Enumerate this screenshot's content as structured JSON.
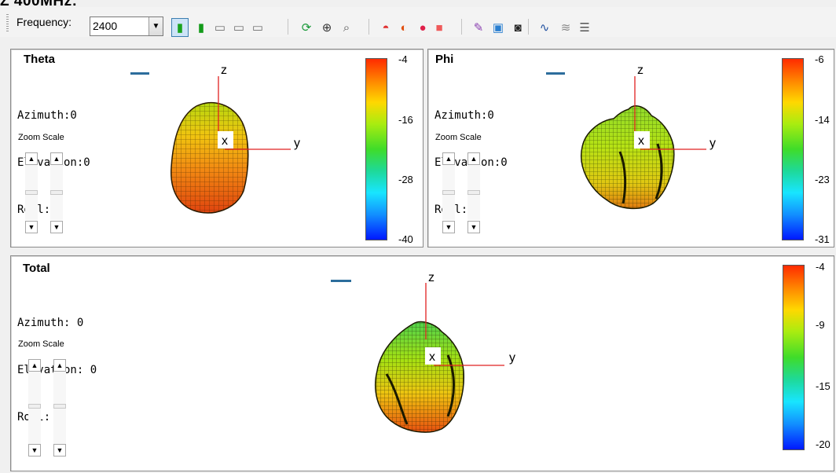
{
  "window": {
    "clipped_title": "Z 400MHz:"
  },
  "toolbar": {
    "frequency_label": "Frequency:",
    "frequency_value": "2400",
    "buttons": [
      {
        "name": "phone-view-icon",
        "glyph": "▮",
        "color": "#19a31c",
        "active": true
      },
      {
        "name": "phone-front-icon",
        "glyph": "▮",
        "color": "#139b1a",
        "active": false
      },
      {
        "name": "device-left-icon",
        "glyph": "▭",
        "color": "#707070",
        "active": false
      },
      {
        "name": "device-right-icon",
        "glyph": "▭",
        "color": "#707070",
        "active": false
      },
      {
        "name": "device-edit-icon",
        "glyph": "▭",
        "color": "#707070",
        "active": false
      },
      {
        "name": "rotate-icon",
        "glyph": "⟳",
        "color": "#1a9a3a",
        "active": false
      },
      {
        "name": "zoom-in-icon",
        "glyph": "⊕",
        "color": "#333333",
        "active": false
      },
      {
        "name": "zoom-out-icon",
        "glyph": "⌕",
        "color": "#555555",
        "active": false
      },
      {
        "name": "sphere-half-icon",
        "glyph": "◓",
        "color": "#e03030",
        "active": false
      },
      {
        "name": "sphere-split-icon",
        "glyph": "◐",
        "color": "#e05010",
        "active": false
      },
      {
        "name": "sphere-icon",
        "glyph": "●",
        "color": "#e0204a",
        "active": false
      },
      {
        "name": "cube-icon",
        "glyph": "■",
        "color": "#ef5a5a",
        "active": false
      },
      {
        "name": "pen-draw-icon",
        "glyph": "✎",
        "color": "#8a3fb0",
        "active": false
      },
      {
        "name": "export-image-icon",
        "glyph": "▣",
        "color": "#2a7fd0",
        "active": false
      },
      {
        "name": "camera-icon",
        "glyph": "◙",
        "color": "#222222",
        "active": false
      },
      {
        "name": "wave-icon",
        "glyph": "∿",
        "color": "#2050a0",
        "active": false
      },
      {
        "name": "multi-wave-icon",
        "glyph": "≋",
        "color": "#8a8a8a",
        "active": false
      },
      {
        "name": "notes-icon",
        "glyph": "☰",
        "color": "#555555",
        "active": false
      }
    ]
  },
  "panels": {
    "theta": {
      "title": "Theta",
      "azimuth": "Azimuth:0",
      "elevation": "Elevation:0",
      "roll": "Roll:0",
      "zoom_label": "Zoom Scale",
      "scale": [
        "-4",
        "-16",
        "-28",
        "-40"
      ]
    },
    "phi": {
      "title": "Phi",
      "azimuth": "Azimuth:0",
      "elevation": "Elevation:0",
      "roll": "Roll:0",
      "zoom_label": "Zoom Scale",
      "scale": [
        "-6",
        "-14",
        "-23",
        "-31"
      ]
    },
    "total": {
      "title": "Total",
      "azimuth": "Azimuth: 0",
      "elevation": "Elevation: 0",
      "roll": "Roll: 0",
      "zoom_label": "Zoom Scale",
      "scale": [
        "-4",
        "-9",
        "-15",
        "-20"
      ]
    }
  },
  "axes": {
    "x": "x",
    "y": "y",
    "z": "z"
  },
  "colors": {
    "axis": "#e02020",
    "legend_mark": "#2c6d9c",
    "window_bg": "#f0f0f0"
  }
}
